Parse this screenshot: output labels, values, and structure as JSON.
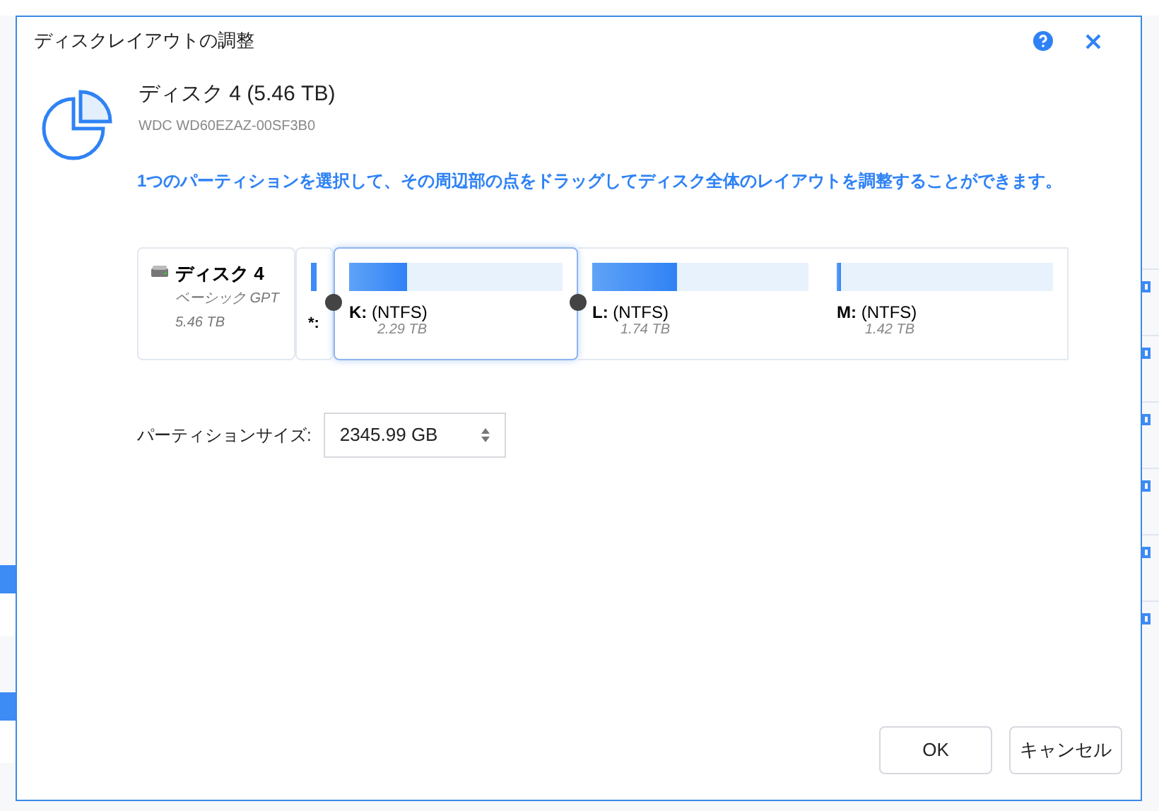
{
  "dialog": {
    "title": "ディスクレイアウトの調整",
    "disk": {
      "title": "ディスク 4 (5.46 TB)",
      "model": "WDC WD60EZAZ-00SF3B0"
    },
    "instruction": "1つのパーティションを選択して、その周辺部の点をドラッグしてディスク全体のレイアウトを調整することができます。",
    "disk_card": {
      "name": "ディスク 4",
      "type": "ベーシック GPT",
      "size": "5.46 TB"
    },
    "partitions": [
      {
        "kind": "small",
        "label": "*:",
        "level": 1,
        "selected": false
      },
      {
        "kind": "normal",
        "label": "**K:** (NTFS)",
        "size": "2.29 TB",
        "level": 0.27,
        "selected": true
      },
      {
        "kind": "normal",
        "label": "**L:** (NTFS)",
        "size": "1.74 TB",
        "level": 0.39,
        "selected": false
      },
      {
        "kind": "normal",
        "label": "**M:** (NTFS)",
        "size": "1.42 TB",
        "level": 0.02,
        "selected": false
      }
    ],
    "size_label": "パーティションサイズ:",
    "size_value": "2345.99 GB",
    "buttons": [
      "OK",
      "キャンセル"
    ]
  }
}
